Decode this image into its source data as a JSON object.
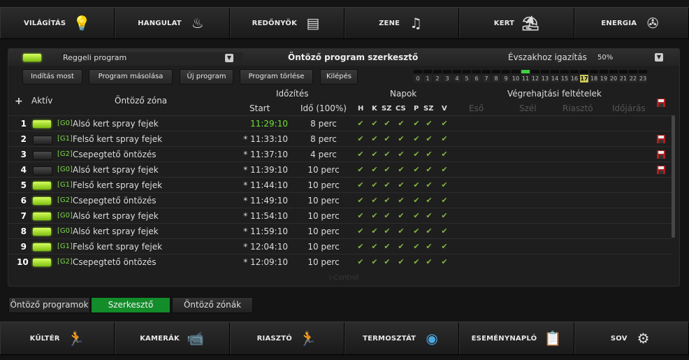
{
  "nav_top": [
    {
      "label": "VILÁGÍTÁS",
      "icon": "lightbulb-icon",
      "glyph": "💡"
    },
    {
      "label": "HANGULAT",
      "icon": "mood-icon",
      "glyph": "♨"
    },
    {
      "label": "REDŐNYÖK",
      "icon": "shutter-icon",
      "glyph": "▤"
    },
    {
      "label": "ZENE",
      "icon": "music-icon",
      "glyph": "♫"
    },
    {
      "label": "KERT",
      "icon": "garden-icon",
      "glyph": "⛱"
    },
    {
      "label": "ENERGIA",
      "icon": "wind-turbine-icon",
      "glyph": "✇"
    }
  ],
  "header": {
    "program": "Reggeli program",
    "title": "Öntöző program szerkesztő",
    "season_label": "Évszakhoz igazítás",
    "season_value": "50%"
  },
  "buttons": {
    "start": "Indítás most",
    "copy": "Program másolása",
    "new": "Új program",
    "delete": "Program törlése",
    "exit": "Kilépés"
  },
  "hours": {
    "labels": [
      "0",
      "1",
      "2",
      "3",
      "4",
      "5",
      "6",
      "7",
      "8",
      "9",
      "10",
      "11",
      "12",
      "13",
      "14",
      "15",
      "16",
      "17",
      "18",
      "19",
      "20",
      "21",
      "22",
      "23"
    ],
    "active": [
      11
    ],
    "current": 17
  },
  "table_header": {
    "add": "+",
    "active": "Aktív",
    "zone": "Öntöző zóna",
    "timing": "Időzítés",
    "start": "Start",
    "duration": "Idő (100%)",
    "days_group": "Napok",
    "days": [
      "H",
      "K",
      "SZ",
      "CS",
      "P",
      "SZ",
      "V"
    ],
    "conditions": "Végrehajtási feltételek",
    "cond_cols": [
      "Eső",
      "Szél",
      "Riasztó",
      "Időjárás"
    ]
  },
  "rows": [
    {
      "n": "1",
      "on": true,
      "code": "[G0]",
      "zone": "Alsó kert spray fejek",
      "start": "11:29:10",
      "dur": "8 perc",
      "current": true,
      "del": false
    },
    {
      "n": "2",
      "on": false,
      "code": "[G1]",
      "zone": "Felső kert spray fejek",
      "start": "* 11:33:10",
      "dur": "8 perc",
      "current": false,
      "del": true
    },
    {
      "n": "3",
      "on": false,
      "code": "[G2]",
      "zone": "Csepegtető öntözés",
      "start": "* 11:37:10",
      "dur": "4 perc",
      "current": false,
      "del": true
    },
    {
      "n": "4",
      "on": false,
      "code": "[G0]",
      "zone": "Alsó kert spray fejek",
      "start": "* 11:39:10",
      "dur": "10 perc",
      "current": false,
      "del": true
    },
    {
      "n": "5",
      "on": true,
      "code": "[G1]",
      "zone": "Felső kert spray fejek",
      "start": "* 11:44:10",
      "dur": "10 perc",
      "current": false,
      "del": false
    },
    {
      "n": "6",
      "on": true,
      "code": "[G2]",
      "zone": "Csepegtető öntözés",
      "start": "* 11:49:10",
      "dur": "10 perc",
      "current": false,
      "del": false
    },
    {
      "n": "7",
      "on": true,
      "code": "[G0]",
      "zone": "Alsó kert spray fejek",
      "start": "* 11:54:10",
      "dur": "10 perc",
      "current": false,
      "del": false
    },
    {
      "n": "8",
      "on": true,
      "code": "[G0]",
      "zone": "Alsó kert spray fejek",
      "start": "* 11:59:10",
      "dur": "10 perc",
      "current": false,
      "del": false
    },
    {
      "n": "9",
      "on": true,
      "code": "[G1]",
      "zone": "Felső kert spray fejek",
      "start": "* 12:04:10",
      "dur": "10 perc",
      "current": false,
      "del": false
    },
    {
      "n": "10",
      "on": true,
      "code": "[G2]",
      "zone": "Csepegtető öntözés",
      "start": "* 12:09:10",
      "dur": "10 perc",
      "current": false,
      "del": false
    }
  ],
  "footer_brand": "i-Control",
  "tabs": [
    "Öntöző programok",
    "Szerkesztő",
    "Öntöző zónák"
  ],
  "nav_bottom": [
    {
      "label": "KÜLTÉR",
      "icon": "outdoor-motion-icon",
      "glyph": "🏃"
    },
    {
      "label": "KAMERÁK",
      "icon": "camera-icon",
      "glyph": "📹"
    },
    {
      "label": "RIASZTÓ",
      "icon": "alarm-icon",
      "glyph": "🏃"
    },
    {
      "label": "TERMOSZTÁT",
      "icon": "thermostat-icon",
      "glyph": "◉"
    },
    {
      "label": "ESEMÉNYNAPLÓ",
      "icon": "event-log-icon",
      "glyph": "📋"
    },
    {
      "label": "SOV",
      "icon": "gears-icon",
      "glyph": "⚙"
    }
  ],
  "colors": {
    "accent_green": "#138c2a",
    "led_green": "#9de02a",
    "current_time": "#6ee038"
  }
}
